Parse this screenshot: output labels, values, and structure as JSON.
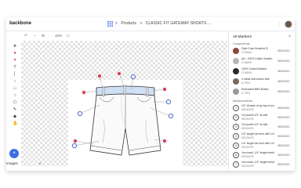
{
  "brand": "backbone",
  "breadcrumbs": [
    "Products",
    ">",
    "CLASSIC FIT GATEWAY SHORTS ..."
  ],
  "toolbar": {
    "zoom": "10%"
  },
  "panel": {
    "title": "19 Markers",
    "section_components": "Components",
    "section_measurements": "Measurements",
    "components": [
      {
        "line1": "Zipin Color Brushed Zi",
        "line2": "COMMIN",
        "date": "08/06/2021",
        "color": "#8b4a3a"
      },
      {
        "line1": "Aw - 100% Cotton Swatch",
        "line2": "COMMIN",
        "date": "08/06/2021",
        "color": "#b5b5b5"
      },
      {
        "line1": "100% Cotton Buttons",
        "line2": "COMMIN",
        "date": "08/06/2021",
        "color": "#2a2a2a"
      },
      {
        "line1": "4 metal rivet button with",
        "line2": "A-TRIM",
        "date": "08/06/2021",
        "color": "#7a6a5a"
      },
      {
        "line1": "Embossed BBS Button",
        "line2": "A-TRIM",
        "date": "08/06/2021",
        "color": "#9a9a9a"
      }
    ],
    "measurements": [
      {
        "num": "1",
        "line1": "1/2 \"at back of zip top of pocket",
        "line2": "MEASURE",
        "date": "08/06/2021"
      },
      {
        "num": "2",
        "line1": "1/2 pocket 1/2\" at side",
        "line2": "MEASURE",
        "date": "08/06/2021"
      },
      {
        "num": "3",
        "line1": "1/2 pocket 1/2\" at side",
        "line2": "MEASURE",
        "date": "08/06/2021"
      },
      {
        "num": "4",
        "line1": "1/4\" single tun from with 1/4\"",
        "line2": "MEASURE",
        "date": "08/06/2021"
      },
      {
        "num": "5",
        "line1": "1/4\" single tun from with 1/4\"",
        "line2": "MEASURE",
        "date": "08/06/2021"
      },
      {
        "num": "6",
        "line1": "1cm mark, 1/4\" single needle sitch",
        "line2": "MEASURE",
        "date": "08/06/2021"
      },
      {
        "num": "7",
        "line1": "1cm mark, 1/4\" single needle sitch",
        "line2": "MEASURE",
        "date": "08/06/2021"
      }
    ]
  },
  "footer": {
    "images_tab": "Images"
  },
  "colors": {
    "accent": "#3d6fe0",
    "marker_red": "#d8344f",
    "marker_blue": "#4e6fd4"
  }
}
